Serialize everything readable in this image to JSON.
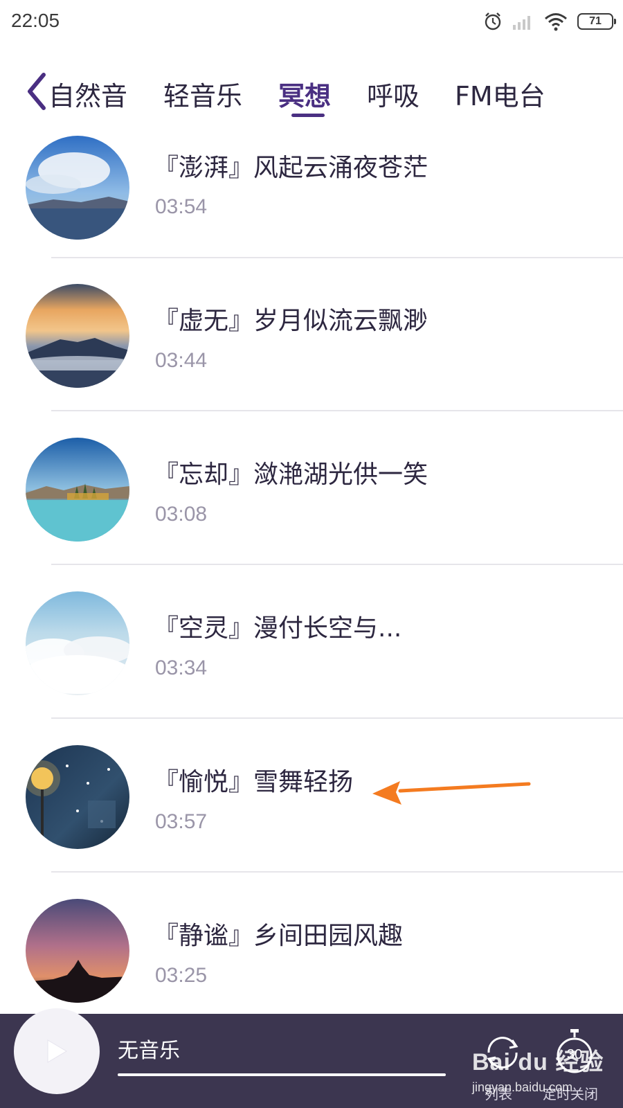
{
  "status_bar": {
    "time": "22:05",
    "battery": "71",
    "icons": [
      "alarm-icon",
      "signal-icon",
      "wifi-icon",
      "battery-icon"
    ]
  },
  "tabs": [
    {
      "label": "自然音",
      "active": false
    },
    {
      "label": "轻音乐",
      "active": false
    },
    {
      "label": "冥想",
      "active": true
    },
    {
      "label": "呼吸",
      "active": false
    },
    {
      "label": "FM电台",
      "active": false
    }
  ],
  "tracks": [
    {
      "title": "『澎湃』风起云涌夜苍茫",
      "duration": "03:54"
    },
    {
      "title": "『虚无』岁月似流云飘渺",
      "duration": "03:44"
    },
    {
      "title": "『忘却』潋滟湖光供一笑",
      "duration": "03:08"
    },
    {
      "title": "『空灵』漫付长空与...",
      "duration": "03:34"
    },
    {
      "title": "『愉悦』雪舞轻扬",
      "duration": "03:57"
    },
    {
      "title": "『静谧』乡间田园风趣",
      "duration": "03:25"
    }
  ],
  "player": {
    "now_playing": "无音乐",
    "timer_value": "30",
    "loop_label": "列表",
    "timer_label": "定时关闭"
  },
  "watermark": {
    "logo": "Bai du 经验",
    "url": "jingyan.baidu.com"
  },
  "colors": {
    "accent": "#4a2f82",
    "player_bg": "#3c3650",
    "annotation": "#f47b20",
    "duration_text": "#9a95a8"
  }
}
